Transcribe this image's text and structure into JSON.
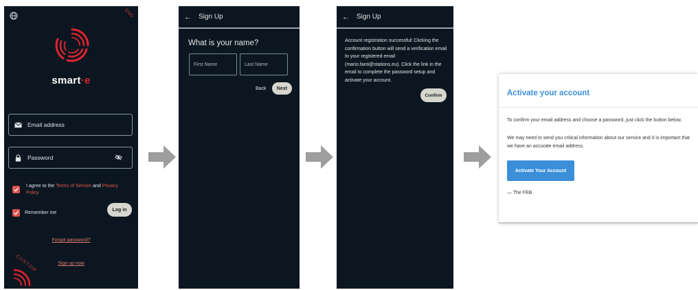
{
  "login": {
    "brand_prefix": "smart",
    "brand_dot": "·",
    "brand_suffix": "e",
    "lang": "ENG",
    "email_placeholder": "Email address",
    "password_placeholder": "Password",
    "terms_prefix": "I agree to the ",
    "terms_link": "Terms of Service",
    "terms_and": " and ",
    "privacy_link": "Privacy Policy",
    "remember": "Remember me",
    "login_button": "Log in",
    "forgot": "Forgot password?",
    "signup": "Sign up now",
    "custom": "CUSTOM"
  },
  "signup_name": {
    "title": "Sign Up",
    "question": "What is your name?",
    "first_name": "First Name",
    "last_name": "Last Name",
    "back": "Back",
    "next": "Next"
  },
  "signup_confirm": {
    "title": "Sign Up",
    "message": "Account registration successful! Clicking the confirmation button will send a verification email to your registered email (mario.fanti@stations.eu). Click the link in the email to complete the password setup and activate your account.",
    "confirm": "Confirm"
  },
  "email": {
    "title": "Activate your account",
    "p1": "To confirm your email address and choose a password, just click the button below.",
    "p2": "We may need to send you critical information about our service and it is important that we have an accurate email address.",
    "button": "Activate Your Account",
    "signature": "— The FEB"
  },
  "colors": {
    "phone_bg": "#0b1620",
    "accent_red": "#e0242e",
    "email_blue": "#3a8fd8",
    "arrow_gray": "#9e9e9e"
  },
  "icons": [
    "globe-icon",
    "mail-icon",
    "lock-icon",
    "eye-off-icon",
    "checkbox-icon",
    "back-arrow-icon",
    "flow-arrow-icon"
  ]
}
